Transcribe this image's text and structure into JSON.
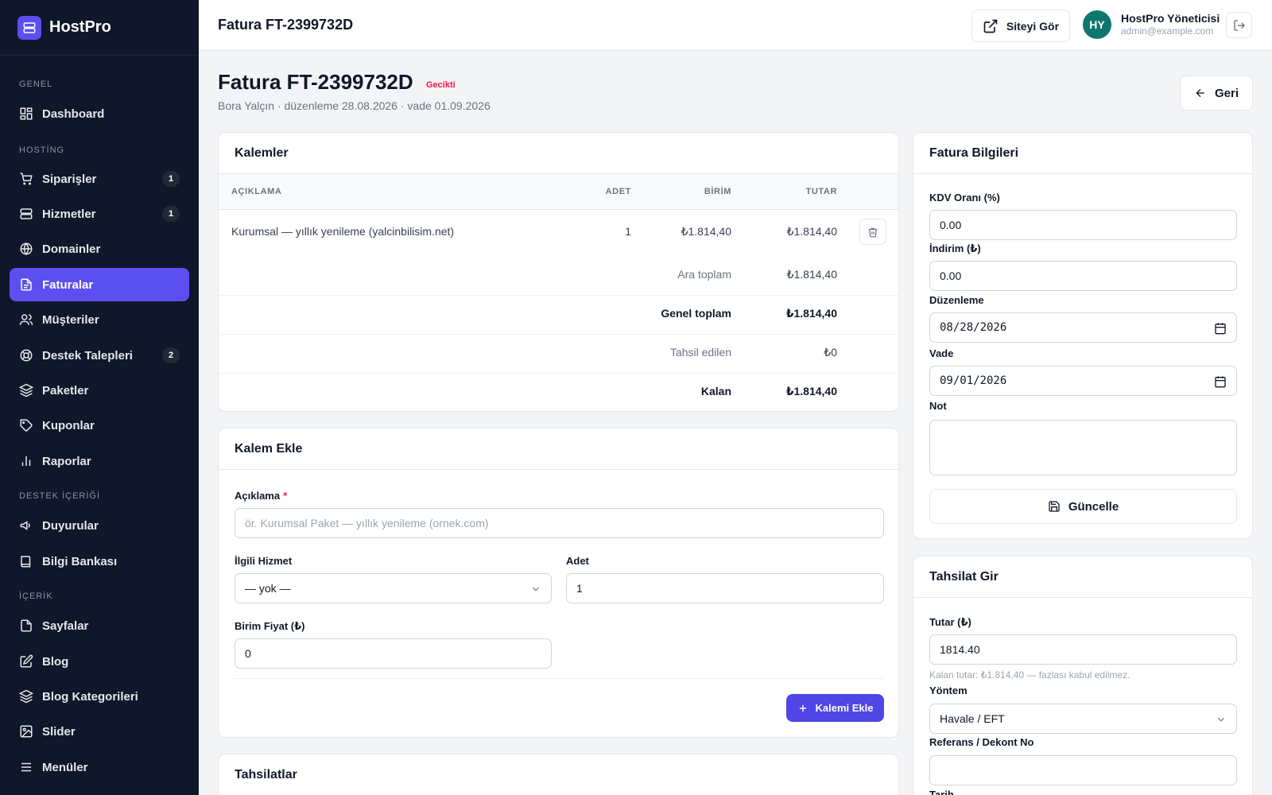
{
  "brand": {
    "name": "HostPro"
  },
  "sidebar": {
    "sections": [
      "GENEL",
      "HOSTİNG",
      "DESTEK İÇERİĞİ",
      "İÇERİK"
    ],
    "items": [
      {
        "label": "Dashboard",
        "icon": "dashboard-icon"
      },
      {
        "label": "Siparişler",
        "icon": "cart-icon",
        "badge": "1"
      },
      {
        "label": "Hizmetler",
        "icon": "server-icon",
        "badge": "1"
      },
      {
        "label": "Domainler",
        "icon": "globe-icon"
      },
      {
        "label": "Faturalar",
        "icon": "file-icon",
        "active": true
      },
      {
        "label": "Müşteriler",
        "icon": "users-icon"
      },
      {
        "label": "Destek Talepleri",
        "icon": "lifebuoy-icon",
        "badge": "2"
      },
      {
        "label": "Paketler",
        "icon": "layers-icon"
      },
      {
        "label": "Kuponlar",
        "icon": "tag-icon"
      },
      {
        "label": "Raporlar",
        "icon": "bar-chart-icon"
      },
      {
        "label": "Duyurular",
        "icon": "megaphone-icon"
      },
      {
        "label": "Bilgi Bankası",
        "icon": "book-icon"
      },
      {
        "label": "Sayfalar",
        "icon": "page-icon"
      },
      {
        "label": "Blog",
        "icon": "edit-icon"
      },
      {
        "label": "Blog Kategorileri",
        "icon": "layers-icon"
      },
      {
        "label": "Slider",
        "icon": "image-icon"
      },
      {
        "label": "Menüler",
        "icon": "menu-icon"
      }
    ]
  },
  "topbar": {
    "title": "Fatura FT-2399732D",
    "site_button": "Siteyi Gör",
    "avatar_initials": "HY",
    "user_name": "HostPro Yöneticisi",
    "user_email": "admin@example.com"
  },
  "page": {
    "title": "Fatura FT-2399732D",
    "status": "Gecikti",
    "subtitle": "Bora Yalçın · düzenleme 28.08.2026 · vade 01.09.2026",
    "back_label": "Geri"
  },
  "items_card": {
    "title": "Kalemler",
    "columns": [
      "AÇIKLAMA",
      "ADET",
      "BİRİM",
      "TUTAR"
    ],
    "rows": [
      {
        "description": "Kurumsal — yıllık yenileme (yalcinbilisim.net)",
        "qty": "1",
        "unit": "₺1.814,40",
        "total": "₺1.814,40"
      }
    ],
    "summary": [
      {
        "label": "Ara toplam",
        "value": "₺1.814,40",
        "bold": false
      },
      {
        "label": "Genel toplam",
        "value": "₺1.814,40",
        "bold": true
      },
      {
        "label": "Tahsil edilen",
        "value": "₺0",
        "bold": false
      },
      {
        "label": "Kalan",
        "value": "₺1.814,40",
        "bold": true
      }
    ]
  },
  "add_item_card": {
    "title": "Kalem Ekle",
    "description_label": "Açıklama",
    "required_mark": "*",
    "description_placeholder": "ör. Kurumsal Paket — yıllık yenileme (ornek.com)",
    "service_label": "İlgili Hizmet",
    "service_value": "— yok —",
    "qty_label": "Adet",
    "qty_value": "1",
    "price_label": "Birim Fiyat (₺)",
    "price_value": "0",
    "submit_label": "Kalemi Ekle"
  },
  "payments_card": {
    "title": "Tahsilatlar"
  },
  "info_card": {
    "title": "Fatura Bilgileri",
    "vat_label": "KDV Oranı (%)",
    "vat_value": "0.00",
    "discount_label": "İndirim (₺)",
    "discount_value": "0.00",
    "issue_label": "Düzenleme",
    "issue_value": "08/28/2026",
    "due_label": "Vade",
    "due_value": "09/01/2026",
    "note_label": "Not",
    "note_value": "",
    "update_label": "Güncelle"
  },
  "payment_entry_card": {
    "title": "Tahsilat Gir",
    "amount_label": "Tutar (₺)",
    "amount_value": "1814.40",
    "amount_hint": "Kalan tutar: ₺1.814,40 — fazlası kabul edilmez.",
    "method_label": "Yöntem",
    "method_value": "Havale / EFT",
    "reference_label": "Referans / Dekont No",
    "reference_value": "",
    "date_label": "Tarih"
  },
  "colors": {
    "sidebar_bg": "#0f172a",
    "accent": "#5b4ff0",
    "primary_button": "#4f46e5",
    "overdue": "#e11d48",
    "avatar": "#0f766e"
  }
}
